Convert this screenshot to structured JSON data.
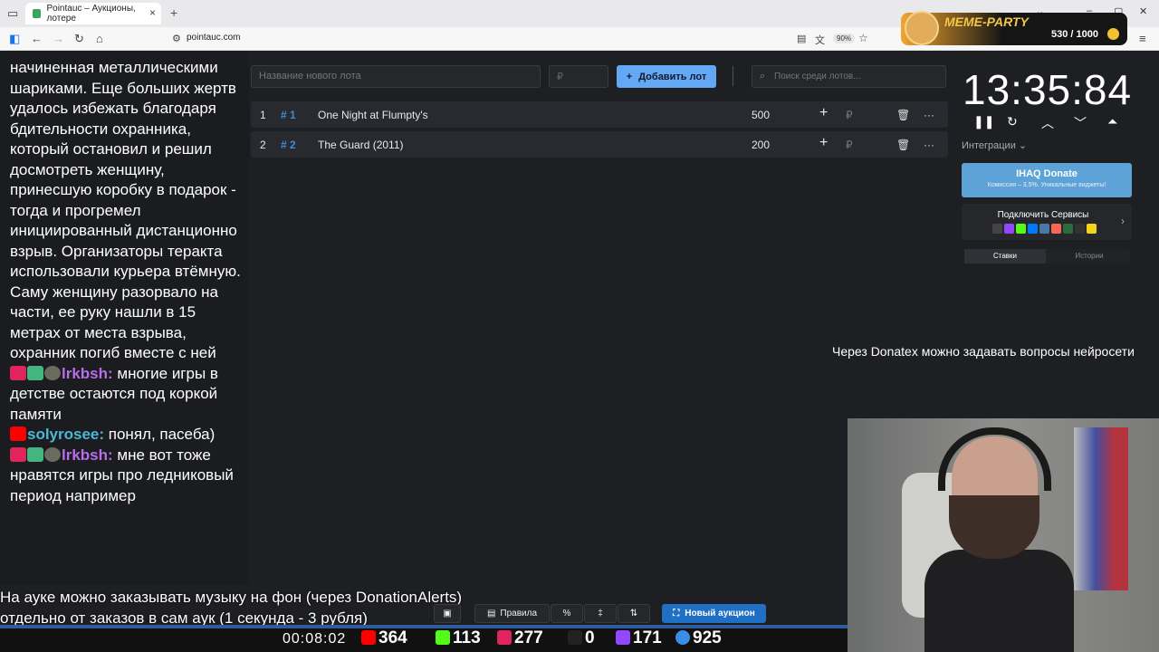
{
  "browser": {
    "tab_title": "Pointauc – Аукционы, лотере",
    "url": "pointauc.com",
    "zoom": "90%"
  },
  "meme_party": {
    "title": "MEME-PARTY",
    "count": "530 / 1000"
  },
  "chat": {
    "text_block": "начиненная металлическими шариками. Еще больших жертв удалось избежать благодаря бдительности охранника, который остановил и решил досмотреть женщину, принесшую коробку в подарок - тогда и прогремел инициированный дистанционно взрыв. Организаторы теракта использовали курьера втёмную. Саму женщину разорвало на части, ее руку нашли в 15 метрах от места взрыва, охранник погиб вместе с ней",
    "messages": [
      {
        "nick": "lrkbsh:",
        "text": " многие игры в детстве остаются под коркой памяти"
      },
      {
        "nick": "solyrosee:",
        "text": " понял, пасеба)"
      },
      {
        "nick": "lrkbsh:",
        "text": " мне вот тоже нравятся игры про ледниковый период например"
      }
    ]
  },
  "auction": {
    "lot_placeholder": "Название нового лота",
    "sum_placeholder": "₽",
    "add_label": "Добавить лот",
    "search_placeholder": "Поиск среди лотов...",
    "lots": [
      {
        "index": "1",
        "hash": "# 1",
        "name": "One Night at Flumpty's",
        "amount": "500"
      },
      {
        "index": "2",
        "hash": "# 2",
        "name": "The Guard (2011)",
        "amount": "200"
      }
    ],
    "currency": "₽"
  },
  "timer": {
    "value": "13:35:84",
    "integrations_label": "Интеграции"
  },
  "ihaq": {
    "title": "IHAQ Donate",
    "subtitle": "Комиссия – 3,5%. Уникальные виджеты!"
  },
  "services": {
    "title": "Подключить Сервисы"
  },
  "tabs": {
    "bets": "Ставки",
    "history": "Истории"
  },
  "donatex_text": "Через Donatex можно задавать вопросы нейросети",
  "ticker": {
    "line1": "На ауке можно заказывать музыку на фон (через DonationAlerts)",
    "line2": "отдельно от заказов в сам аук (1 секунда - 3 рубля)"
  },
  "bottom_toolbar": {
    "rules": "Правила",
    "new_auction": "Новый аукцион"
  },
  "hud": {
    "time": "00:08:02",
    "youtube": "364",
    "kick": "113",
    "vk": "277",
    "rumble": "0",
    "twitch": "171",
    "viewers": "925"
  },
  "colors": {
    "accent": "#64a7f4",
    "lot_hash": "#3f8bd8",
    "nick_purple": "#b76ee8",
    "nick_blue": "#4ab8d6"
  }
}
